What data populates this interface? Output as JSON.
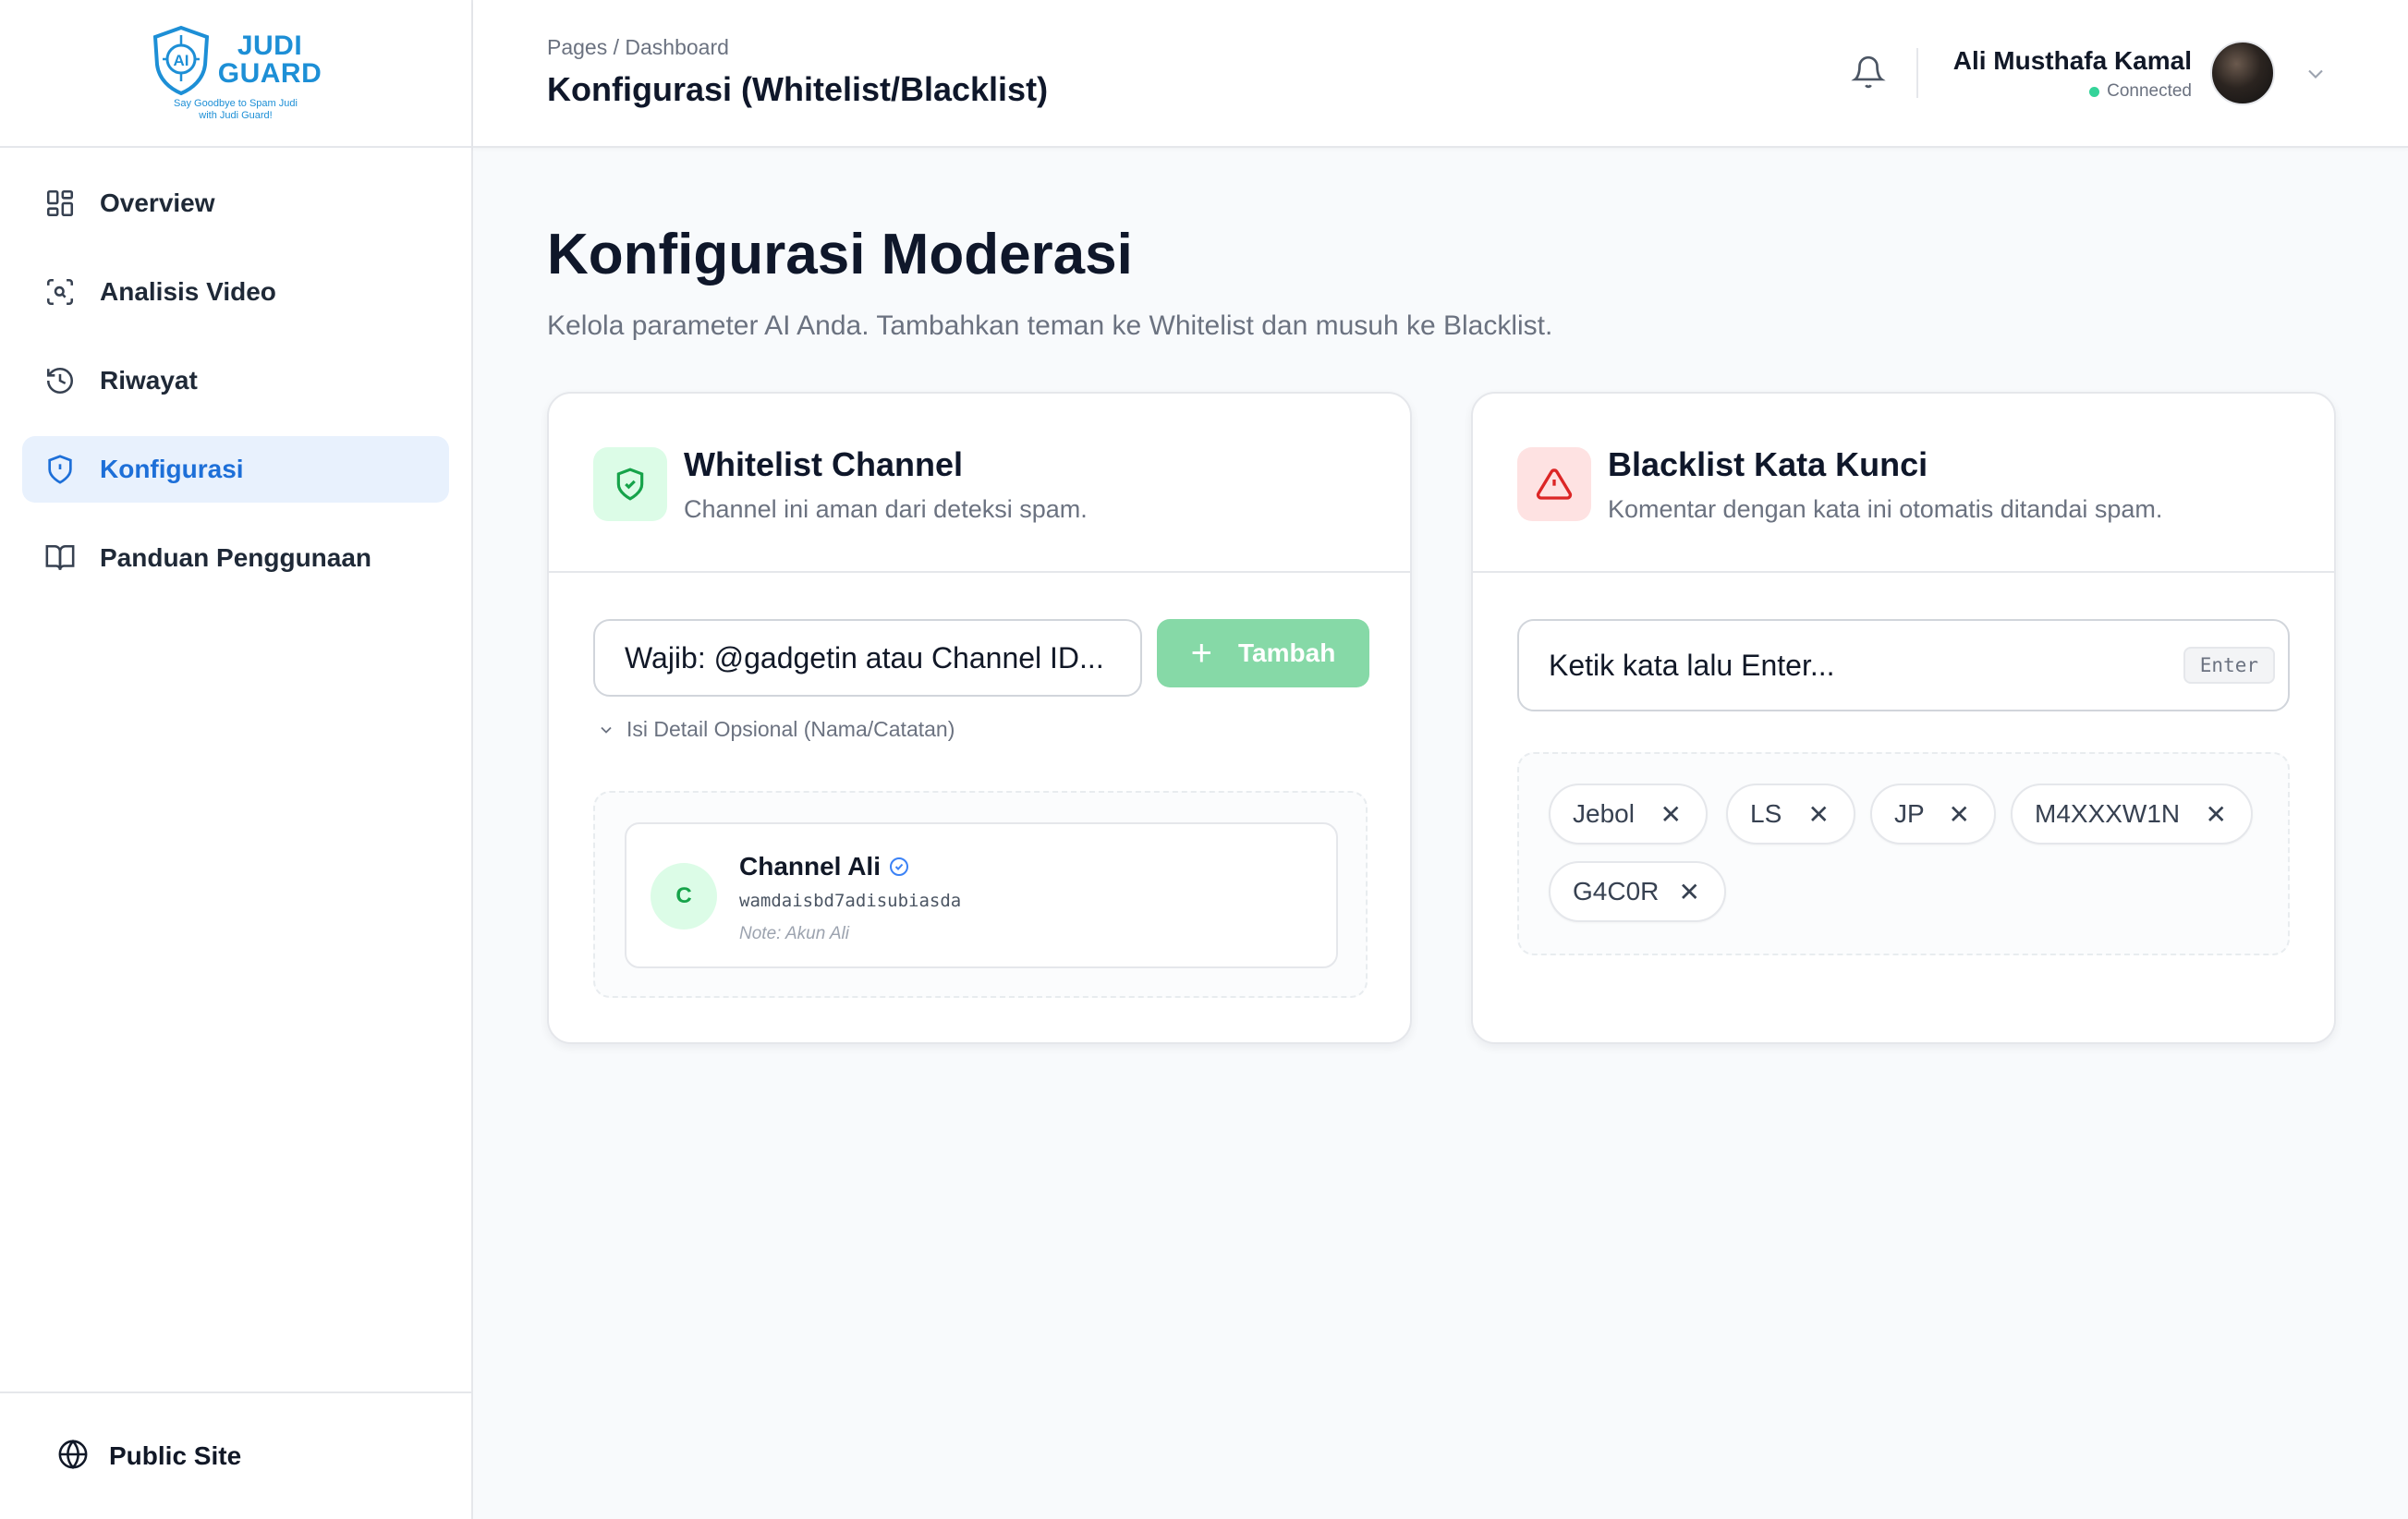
{
  "brand": {
    "name_line1": "JUDI",
    "name_line2": "GUARD",
    "tagline_line1": "Say Goodbye to Spam Judi",
    "tagline_line2": "with Judi Guard!",
    "accent": "#1d8fd6"
  },
  "sidebar": {
    "items": [
      {
        "label": "Overview",
        "icon": "grid-icon",
        "active": false
      },
      {
        "label": "Analisis Video",
        "icon": "scan-search-icon",
        "active": false
      },
      {
        "label": "Riwayat",
        "icon": "history-icon",
        "active": false
      },
      {
        "label": "Konfigurasi",
        "icon": "shield-alert-icon",
        "active": true
      },
      {
        "label": "Panduan Penggunaan",
        "icon": "book-icon",
        "active": false
      }
    ],
    "footer_label": "Public Site"
  },
  "header": {
    "breadcrumb": "Pages / Dashboard",
    "title": "Konfigurasi (Whitelist/Blacklist)",
    "user_name": "Ali Musthafa Kamal",
    "user_status": "Connected"
  },
  "page": {
    "heading": "Konfigurasi Moderasi",
    "subheading": "Kelola parameter AI Anda. Tambahkan teman ke Whitelist dan musuh ke Blacklist."
  },
  "whitelist": {
    "title": "Whitelist Channel",
    "subtitle": "Channel ini aman dari deteksi spam.",
    "input_placeholder": "Wajib: @gadgetin atau Channel ID...",
    "add_label": "Tambah",
    "optional_label": "Isi Detail Opsional (Nama/Catatan)",
    "channels": [
      {
        "initial": "C",
        "name": "Channel Ali",
        "id": "wamdaisbd7adisubiasda",
        "note": "Note: Akun Ali"
      }
    ]
  },
  "blacklist": {
    "title": "Blacklist Kata Kunci",
    "subtitle": "Komentar dengan kata ini otomatis ditandai spam.",
    "input_placeholder": "Ketik kata lalu Enter...",
    "enter_hint": "Enter",
    "keywords": [
      "Jebol",
      "LS",
      "JP",
      "M4XXXW1N",
      "G4C0R"
    ]
  },
  "colors": {
    "active_nav_bg": "#e8f1fd",
    "active_nav_text": "#1d6fd8",
    "add_button": "#86d9a7",
    "whitelist_icon_bg": "#dcfce7",
    "blacklist_icon_bg": "#fee2e2",
    "status_dot": "#34d399"
  }
}
